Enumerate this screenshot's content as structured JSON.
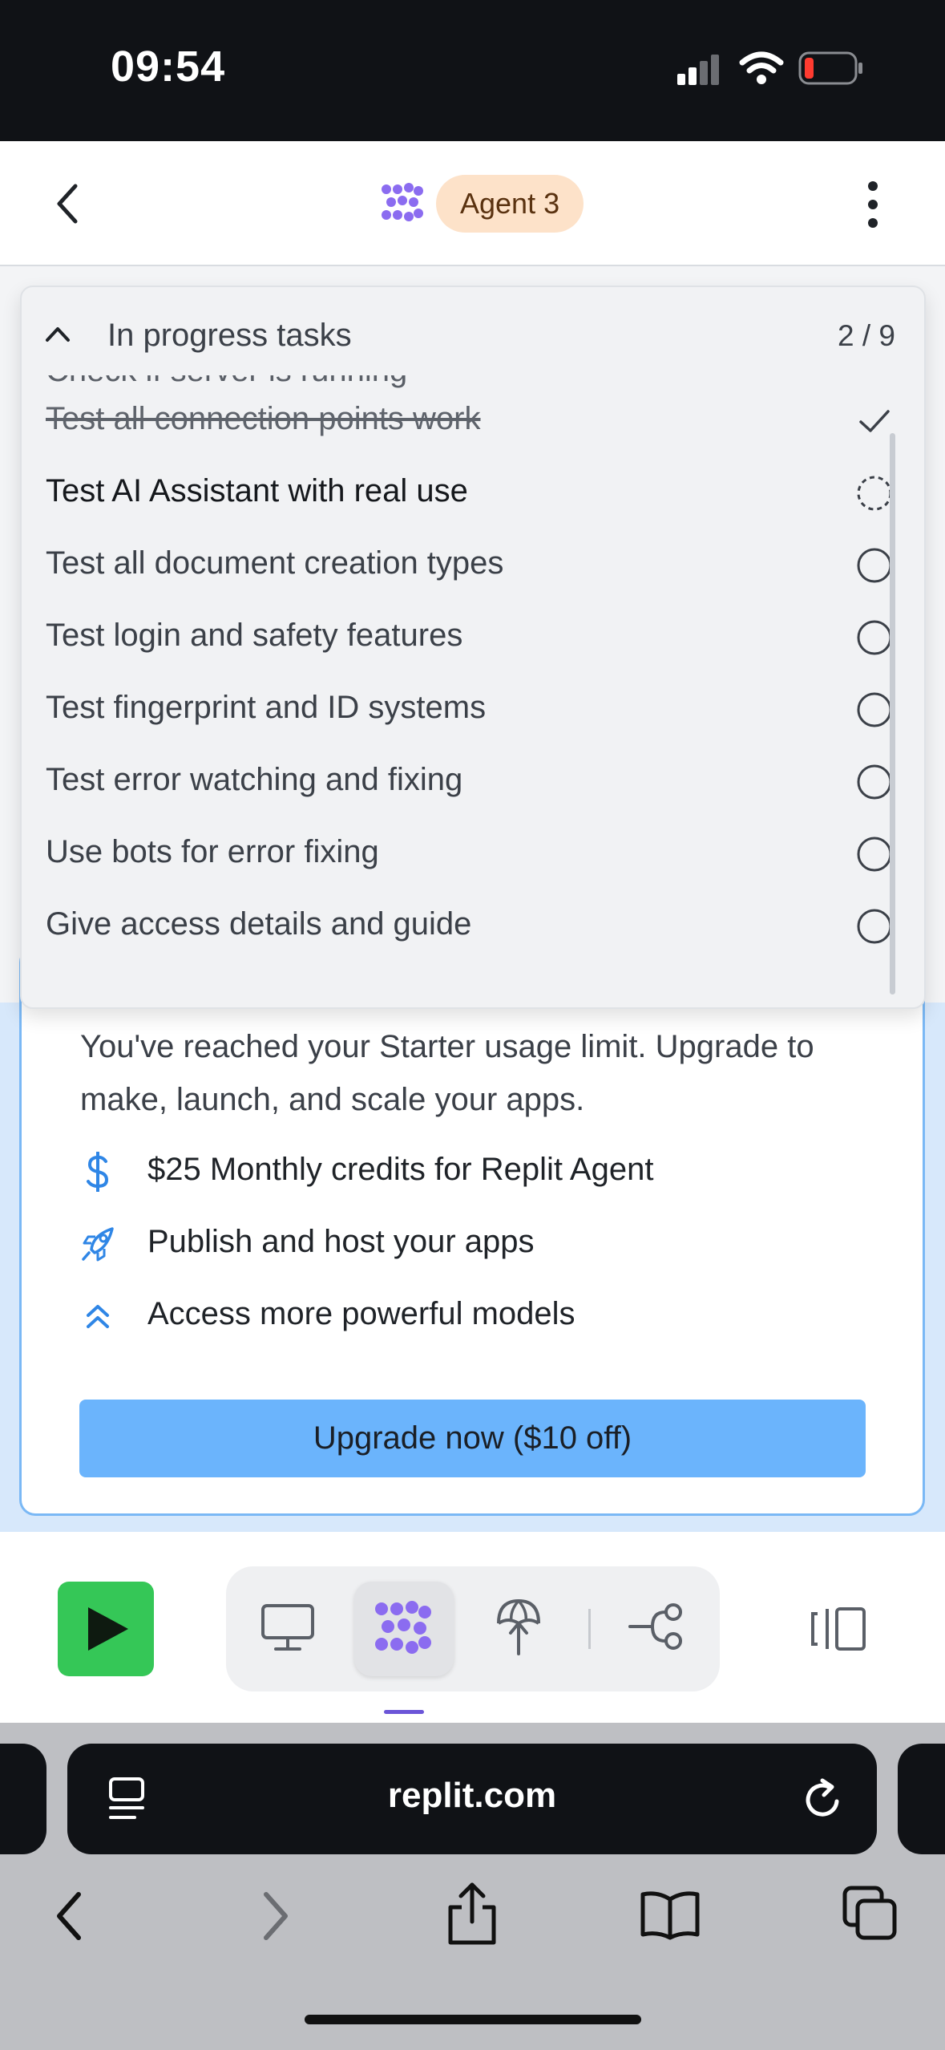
{
  "status_bar": {
    "time": "09:54"
  },
  "header": {
    "badge_label": "Agent 3"
  },
  "tasks": {
    "title": "In progress tasks",
    "count": "2 / 9",
    "cut_off_item": "Check if server is running",
    "items": [
      {
        "label": "Test all connection points work",
        "status": "done"
      },
      {
        "label": "Test AI Assistant with real use",
        "status": "in-progress"
      },
      {
        "label": "Test all document creation types",
        "status": "pending"
      },
      {
        "label": "Test login and safety features",
        "status": "pending"
      },
      {
        "label": "Test fingerprint and ID systems",
        "status": "pending"
      },
      {
        "label": "Test error watching and fixing",
        "status": "pending"
      },
      {
        "label": "Use bots for error fixing",
        "status": "pending"
      },
      {
        "label": "Give access details and guide",
        "status": "pending"
      }
    ]
  },
  "upgrade": {
    "message": "You've reached your Starter usage limit. Upgrade to make, launch, and scale your apps.",
    "features": [
      {
        "icon": "dollar-icon",
        "label": "$25 Monthly credits for Replit Agent"
      },
      {
        "icon": "rocket-icon",
        "label": "Publish and host your apps"
      },
      {
        "icon": "double-chevron-up-icon",
        "label": "Access more powerful models"
      }
    ],
    "button_label": "Upgrade now ($10 off)"
  },
  "browser": {
    "url": "replit.com"
  },
  "colors": {
    "accent_blue": "#6bb4fc",
    "run_green": "#35c757",
    "agent_purple": "#8b6cf0",
    "badge_bg": "#fde2c9"
  }
}
